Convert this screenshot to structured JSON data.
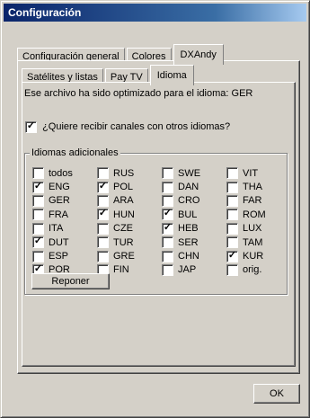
{
  "window": {
    "title": "Configuración"
  },
  "tabs": [
    {
      "label": "Configuración general",
      "active": false
    },
    {
      "label": "Colores",
      "active": false
    },
    {
      "label": "DXAndy",
      "active": true
    }
  ],
  "subtabs": [
    {
      "label": "Satélites y listas",
      "active": false
    },
    {
      "label": "Pay TV",
      "active": false
    },
    {
      "label": "Idioma",
      "active": true
    }
  ],
  "idioma": {
    "optimized_text": "Ese archivo ha sido optimizado para el idioma: GER",
    "receive_other": {
      "label": "¿Quiere recibir canales con otros idiomas?",
      "checked": true
    },
    "group_title": "Idiomas adicionales",
    "languages": [
      {
        "label": "todos",
        "checked": false
      },
      {
        "label": "RUS",
        "checked": false
      },
      {
        "label": "SWE",
        "checked": false
      },
      {
        "label": "VIT",
        "checked": false
      },
      {
        "label": "ENG",
        "checked": true
      },
      {
        "label": "POL",
        "checked": true
      },
      {
        "label": "DAN",
        "checked": false
      },
      {
        "label": "THA",
        "checked": false
      },
      {
        "label": "GER",
        "checked": false
      },
      {
        "label": "ARA",
        "checked": false
      },
      {
        "label": "CRO",
        "checked": false
      },
      {
        "label": "FAR",
        "checked": false
      },
      {
        "label": "FRA",
        "checked": false
      },
      {
        "label": "HUN",
        "checked": true
      },
      {
        "label": "BUL",
        "checked": true
      },
      {
        "label": "ROM",
        "checked": false
      },
      {
        "label": "ITA",
        "checked": false
      },
      {
        "label": "CZE",
        "checked": false
      },
      {
        "label": "HEB",
        "checked": true
      },
      {
        "label": "LUX",
        "checked": false
      },
      {
        "label": "DUT",
        "checked": true
      },
      {
        "label": "TUR",
        "checked": false
      },
      {
        "label": "SER",
        "checked": false
      },
      {
        "label": "TAM",
        "checked": false
      },
      {
        "label": "ESP",
        "checked": false
      },
      {
        "label": "GRE",
        "checked": false
      },
      {
        "label": "CHN",
        "checked": false
      },
      {
        "label": "KUR",
        "checked": true
      },
      {
        "label": "POR",
        "checked": true
      },
      {
        "label": "FIN",
        "checked": false
      },
      {
        "label": "JAP",
        "checked": false
      },
      {
        "label": "orig.",
        "checked": false
      }
    ],
    "reset_button": "Reponer"
  },
  "buttons": {
    "ok": "OK"
  }
}
